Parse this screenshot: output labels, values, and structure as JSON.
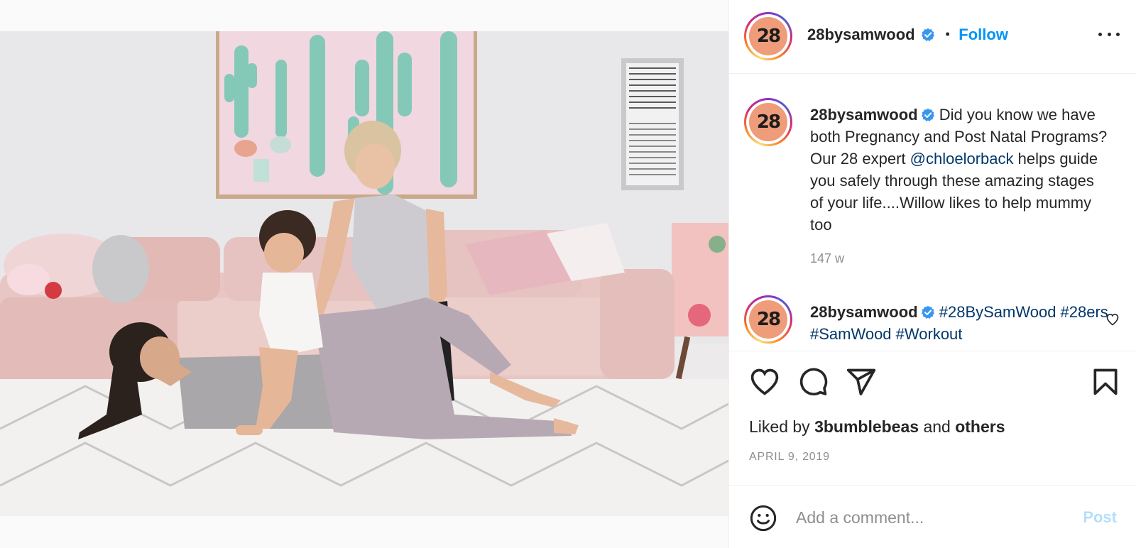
{
  "post": {
    "avatar_text": "28",
    "username": "28bysamwood",
    "separator": "•",
    "follow_label": "Follow",
    "photo_alt": "Woman doing a side-lying exercise on a rug with a toddler while a trainer assists"
  },
  "caption": {
    "username": "28bysamwood",
    "text_1": " Did you know we have both Pregnancy and Post Natal Programs? Our 28 expert ",
    "mention": "@chloelorback",
    "text_2": " helps guide you safely through these amazing stages of your life....Willow likes to help mummy too",
    "time": "147 w"
  },
  "hashtag_comment": {
    "username": "28bysamwood",
    "hashtags": "#28BySamWood #28ers #SamWood #Workout"
  },
  "engagement": {
    "liked_prefix": "Liked by ",
    "liked_user": "3bumblebeas",
    "liked_middle": " and ",
    "liked_suffix": "others",
    "date": "APRIL 9, 2019"
  },
  "composer": {
    "placeholder": "Add a comment...",
    "post_label": "Post"
  },
  "icons": {
    "verified": "verified-badge-icon",
    "more": "more-options-icon",
    "like": "heart-icon",
    "comment": "comment-icon",
    "share": "send-icon",
    "save": "bookmark-icon",
    "emoji": "emoji-icon"
  },
  "colors": {
    "accent": "#0095f6",
    "link": "#00376b",
    "muted": "#8e8e8e",
    "post_disabled": "#b2dffc",
    "avatar_bg": "#ee9c7a"
  }
}
